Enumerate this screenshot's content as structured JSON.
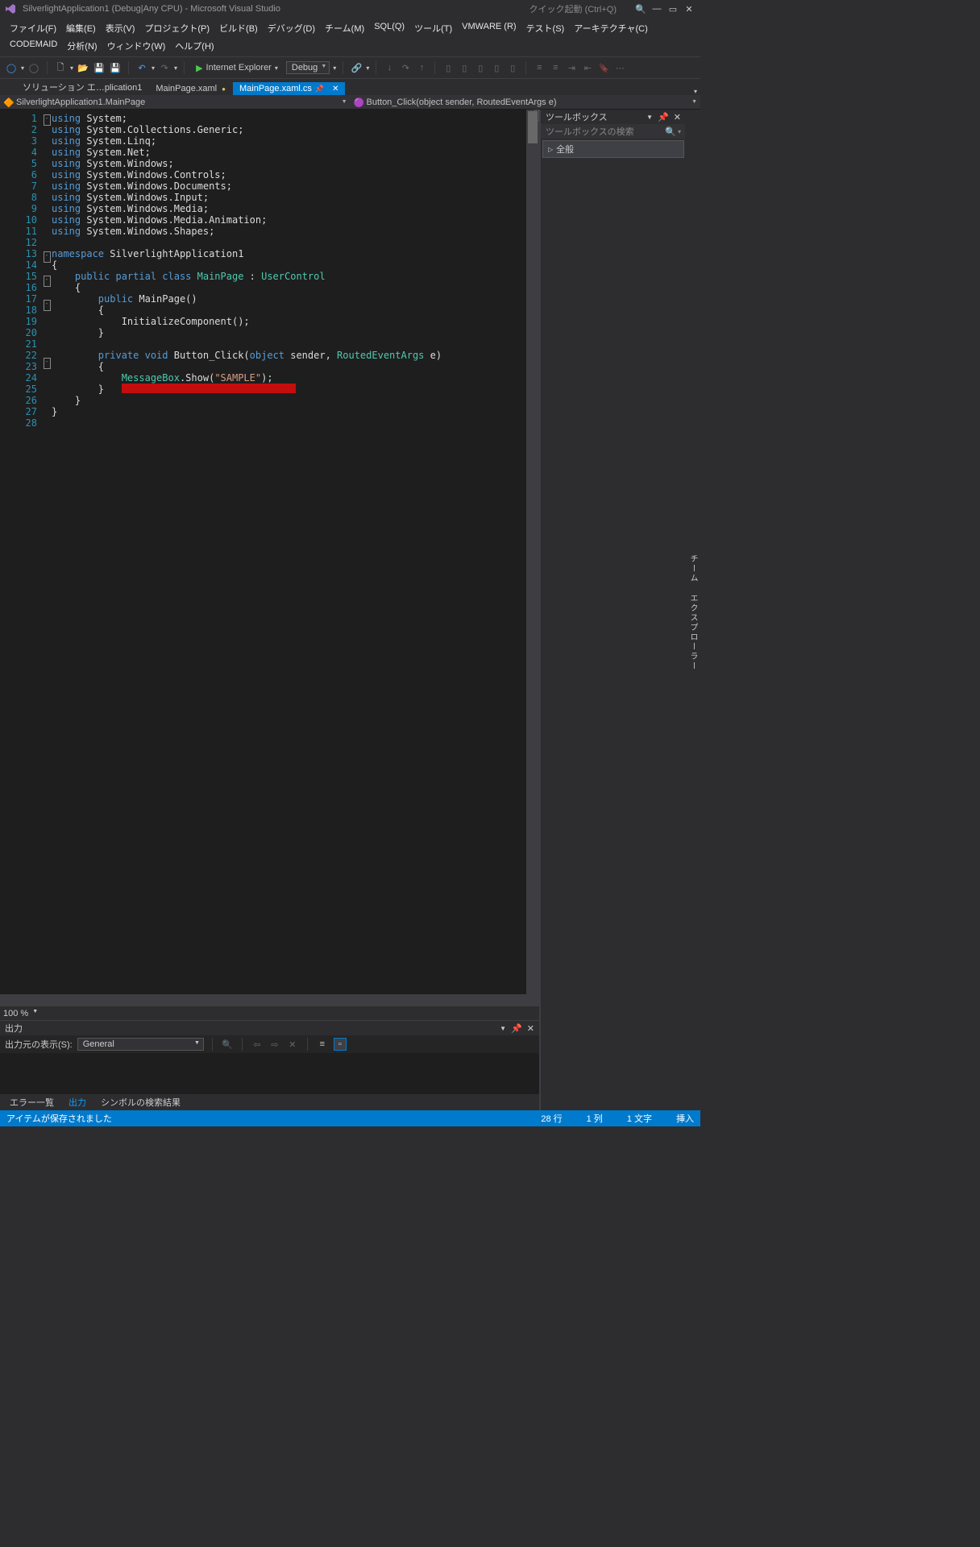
{
  "titlebar": {
    "title": "SilverlightApplication1 (Debug|Any CPU) - Microsoft Visual Studio",
    "quick_launch": "クイック起動 (Ctrl+Q)"
  },
  "menu": {
    "file": "ファイル(F)",
    "edit": "編集(E)",
    "view": "表示(V)",
    "project": "プロジェクト(P)",
    "build": "ビルド(B)",
    "debug": "デバッグ(D)",
    "team": "チーム(M)",
    "sql": "SQL(Q)",
    "tools": "ツール(T)",
    "vmware": "VMWARE (R)",
    "test": "テスト(S)",
    "architecture": "アーキテクチャ(C)",
    "codemaid": "CODEMAID",
    "analyze": "分析(N)",
    "window": "ウィンドウ(W)",
    "help": "ヘルプ(H)"
  },
  "toolbar": {
    "run_target": "Internet Explorer",
    "config": "Debug"
  },
  "tabs": {
    "t1": "ソリューション エ…plication1",
    "t2": "MainPage.xaml",
    "t3": "MainPage.xaml.cs"
  },
  "navbar": {
    "left": "SilverlightApplication1.MainPage",
    "right": "Button_Click(object sender, RoutedEventArgs e)"
  },
  "code": {
    "lines": [
      [
        [
          "k-blue",
          "using "
        ],
        [
          "k-w",
          "System;"
        ]
      ],
      [
        [
          "k-blue",
          "using "
        ],
        [
          "k-w",
          "System.Collections.Generic;"
        ]
      ],
      [
        [
          "k-blue",
          "using "
        ],
        [
          "k-w",
          "System.Linq;"
        ]
      ],
      [
        [
          "k-blue",
          "using "
        ],
        [
          "k-w",
          "System.Net;"
        ]
      ],
      [
        [
          "k-blue",
          "using "
        ],
        [
          "k-w",
          "System.Windows;"
        ]
      ],
      [
        [
          "k-blue",
          "using "
        ],
        [
          "k-w",
          "System.Windows.Controls;"
        ]
      ],
      [
        [
          "k-blue",
          "using "
        ],
        [
          "k-w",
          "System.Windows.Documents;"
        ]
      ],
      [
        [
          "k-blue",
          "using "
        ],
        [
          "k-w",
          "System.Windows.Input;"
        ]
      ],
      [
        [
          "k-blue",
          "using "
        ],
        [
          "k-w",
          "System.Windows.Media;"
        ]
      ],
      [
        [
          "k-blue",
          "using "
        ],
        [
          "k-w",
          "System.Windows.Media.Animation;"
        ]
      ],
      [
        [
          "k-blue",
          "using "
        ],
        [
          "k-w",
          "System.Windows.Shapes;"
        ]
      ],
      [
        [
          "k-w",
          ""
        ]
      ],
      [
        [
          "k-blue",
          "namespace "
        ],
        [
          "k-w",
          "SilverlightApplication1"
        ]
      ],
      [
        [
          "k-w",
          "{"
        ]
      ],
      [
        [
          "k-w",
          "    "
        ],
        [
          "k-blue",
          "public partial class "
        ],
        [
          "k-type",
          "MainPage"
        ],
        [
          "k-w",
          " : "
        ],
        [
          "k-type",
          "UserControl"
        ]
      ],
      [
        [
          "k-w",
          "    {"
        ]
      ],
      [
        [
          "k-w",
          "        "
        ],
        [
          "k-blue",
          "public "
        ],
        [
          "k-w",
          "MainPage()"
        ]
      ],
      [
        [
          "k-w",
          "        {"
        ]
      ],
      [
        [
          "k-w",
          "            InitializeComponent();"
        ]
      ],
      [
        [
          "k-w",
          "        }"
        ]
      ],
      [
        [
          "k-w",
          ""
        ]
      ],
      [
        [
          "k-w",
          "        "
        ],
        [
          "k-blue",
          "private void "
        ],
        [
          "k-w",
          "Button_Click("
        ],
        [
          "k-blue",
          "object"
        ],
        [
          "k-w",
          " sender, "
        ],
        [
          "k-type",
          "RoutedEventArgs"
        ],
        [
          "k-w",
          " e)"
        ]
      ],
      [
        [
          "k-w",
          "        {"
        ]
      ],
      [
        [
          "k-w",
          "            "
        ],
        [
          "k-type",
          "MessageBox"
        ],
        [
          "k-w",
          ".Show("
        ],
        [
          "k-str",
          "\"SAMPLE\""
        ],
        [
          "k-w",
          ");"
        ]
      ],
      [
        [
          "k-w",
          "        }   "
        ],
        [
          "red-hl",
          "                              "
        ]
      ],
      [
        [
          "k-w",
          "    }"
        ]
      ],
      [
        [
          "k-w",
          "}"
        ]
      ],
      [
        [
          "k-w",
          ""
        ]
      ]
    ]
  },
  "zoom": "100 %",
  "output": {
    "title": "出力",
    "from_label": "出力元の表示(S):",
    "from_value": "General",
    "tabs": {
      "errors": "エラー一覧",
      "output": "出力",
      "symbols": "シンボルの検索結果"
    }
  },
  "toolbox": {
    "title": "ツールボックス",
    "search": "ツールボックスの検索",
    "general": "全般"
  },
  "siderail": {
    "team": "チーム エクスプローラー"
  },
  "status": {
    "msg": "アイテムが保存されました",
    "line": "28 行",
    "col": "1 列",
    "char": "1 文字",
    "ins": "挿入"
  }
}
